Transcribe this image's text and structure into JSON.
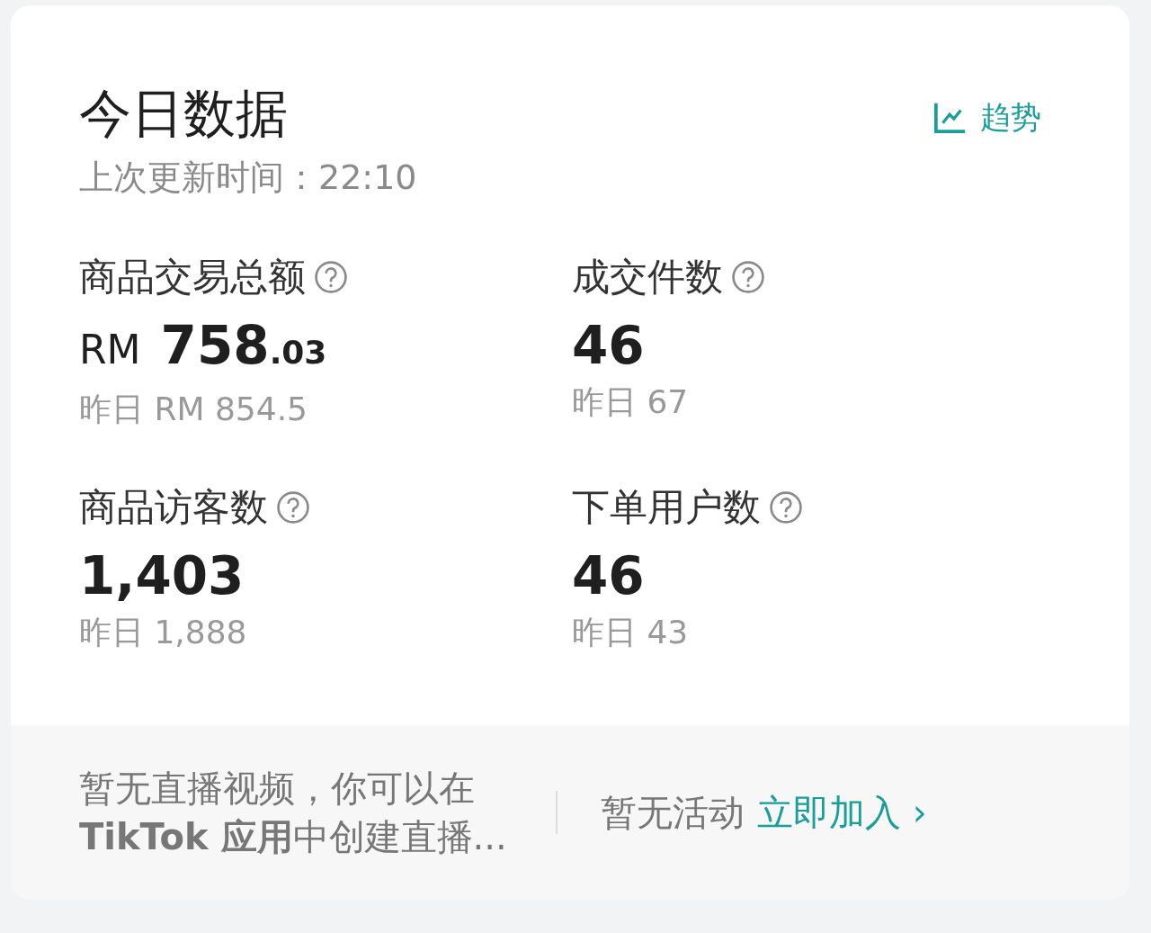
{
  "header": {
    "title": "今日数据",
    "updated": "上次更新时间：22:10",
    "trend_link": "趋势"
  },
  "metrics": [
    {
      "label": "商品交易总额",
      "currency": "RM",
      "value": "758",
      "decimal": ".03",
      "yesterday": "昨日 RM 854.5"
    },
    {
      "label": "成交件数",
      "value": "46",
      "yesterday": "昨日 67"
    },
    {
      "label": "商品访客数",
      "value": "1,403",
      "yesterday": "昨日 1,888"
    },
    {
      "label": "下单用户数",
      "value": "46",
      "yesterday": "昨日 43"
    }
  ],
  "footer": {
    "live_note": "暂无直播视频，你可以在**TikTok 应用**中创建直播...",
    "activity_note": "暂无活动",
    "join_link": "立即加入",
    "join_arrow": "›"
  }
}
